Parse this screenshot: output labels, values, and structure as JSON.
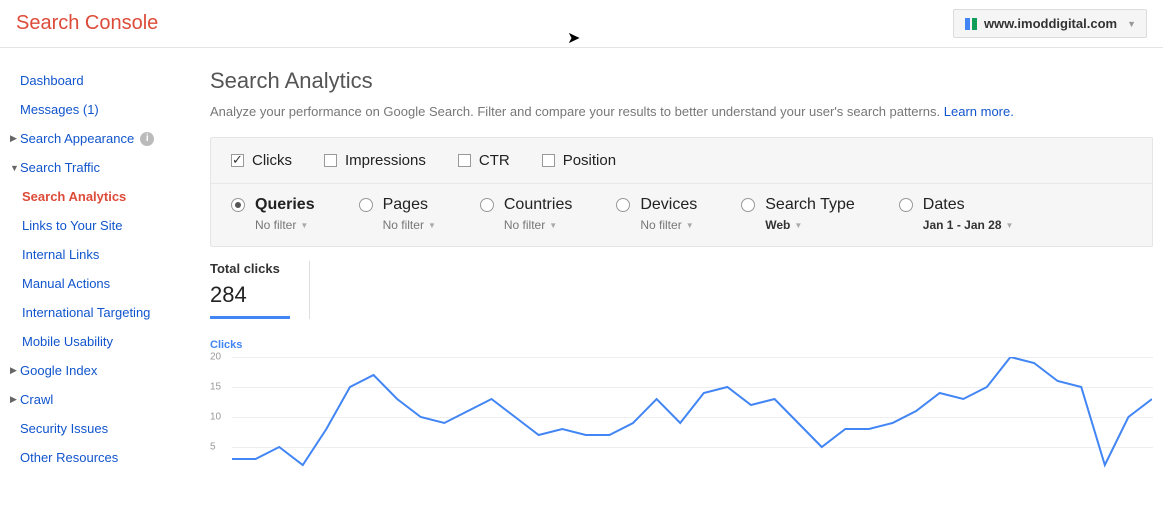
{
  "header": {
    "brand": "Search Console",
    "site": "www.imoddigital.com"
  },
  "sidebar": {
    "dashboard": "Dashboard",
    "messages": "Messages (1)",
    "search_appearance": "Search Appearance",
    "search_traffic": "Search Traffic",
    "search_traffic_children": {
      "search_analytics": "Search Analytics",
      "links_to_site": "Links to Your Site",
      "internal_links": "Internal Links",
      "manual_actions": "Manual Actions",
      "intl_targeting": "International Targeting",
      "mobile_usability": "Mobile Usability"
    },
    "google_index": "Google Index",
    "crawl": "Crawl",
    "security_issues": "Security Issues",
    "other_resources": "Other Resources"
  },
  "page": {
    "title": "Search Analytics",
    "subtitle": "Analyze your performance on Google Search. Filter and compare your results to better understand your user's search patterns. ",
    "learn_more": "Learn more."
  },
  "metrics": {
    "clicks": "Clicks",
    "impressions": "Impressions",
    "ctr": "CTR",
    "position": "Position"
  },
  "dimensions": {
    "queries": {
      "label": "Queries",
      "sub": "No filter"
    },
    "pages": {
      "label": "Pages",
      "sub": "No filter"
    },
    "countries": {
      "label": "Countries",
      "sub": "No filter"
    },
    "devices": {
      "label": "Devices",
      "sub": "No filter"
    },
    "search_type": {
      "label": "Search Type",
      "sub": "Web"
    },
    "dates": {
      "label": "Dates",
      "sub": "Jan 1 - Jan 28"
    }
  },
  "totals": {
    "label": "Total clicks",
    "value": "284"
  },
  "chart_legend": "Clicks",
  "chart_data": {
    "type": "line",
    "ylabel": "Clicks",
    "ylim": [
      0,
      20
    ],
    "yticks": [
      5,
      10,
      15,
      20
    ],
    "values": [
      3,
      3,
      5,
      2,
      8,
      15,
      17,
      13,
      10,
      9,
      11,
      13,
      10,
      7,
      8,
      7,
      7,
      9,
      13,
      9,
      14,
      15,
      12,
      13,
      9,
      5,
      8,
      8,
      9,
      11,
      14,
      13,
      15,
      20,
      19,
      16,
      15,
      2,
      10,
      13
    ]
  }
}
